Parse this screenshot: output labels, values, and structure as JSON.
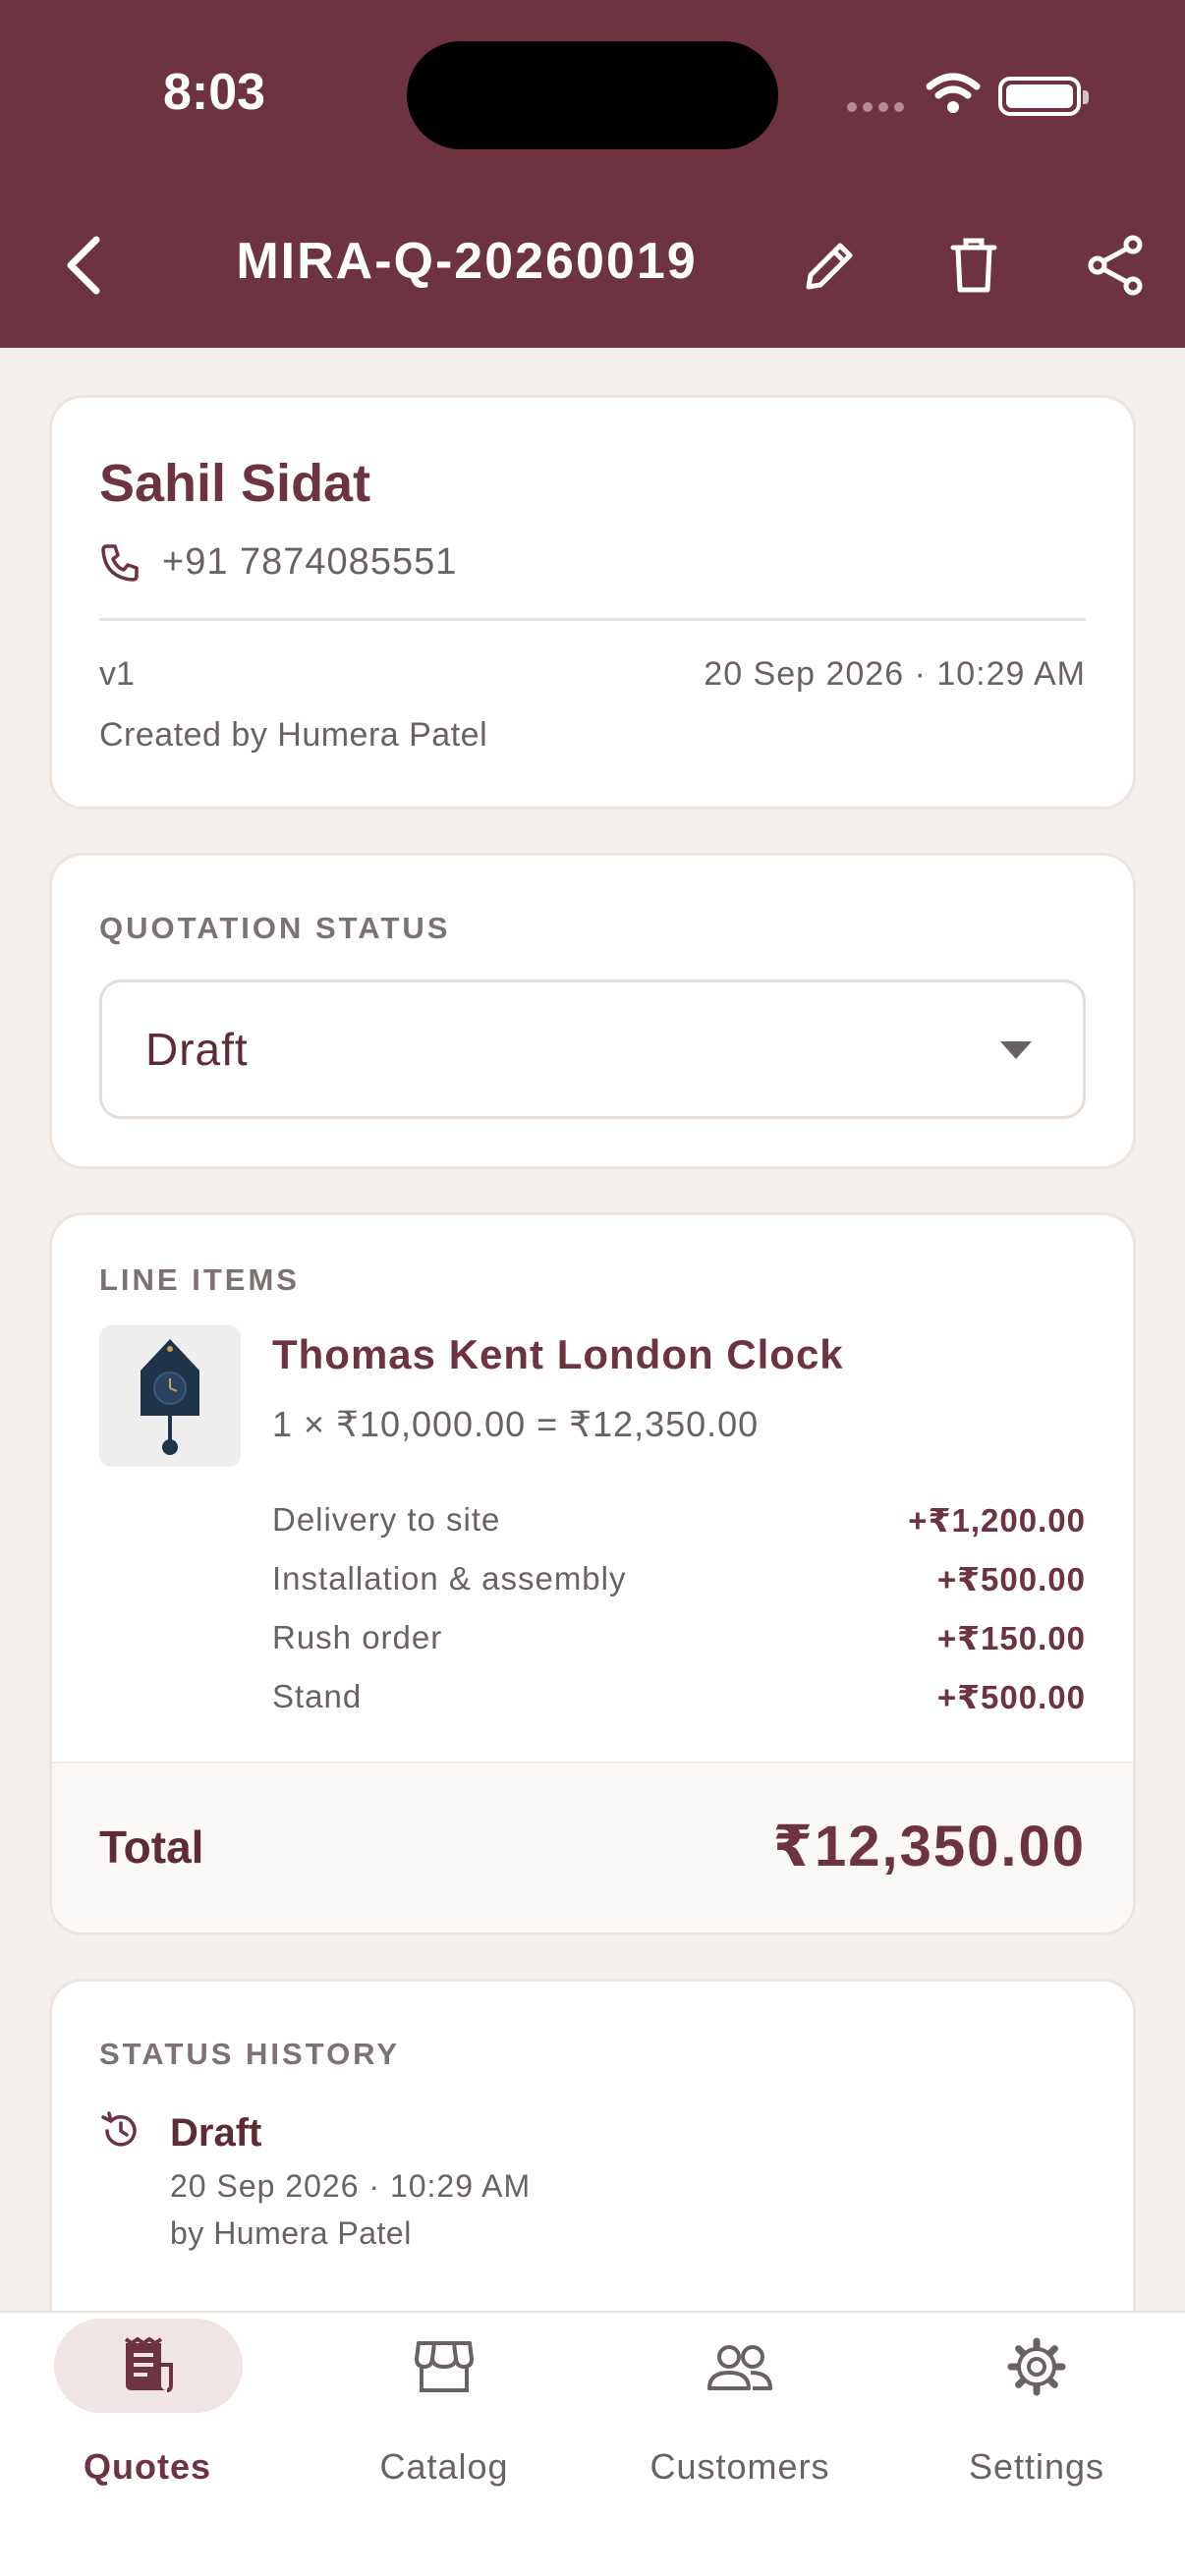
{
  "status_bar": {
    "time": "8:03"
  },
  "app_bar": {
    "title": "MIRA-Q-20260019",
    "back_icon": "back-arrow-icon",
    "edit_icon": "pencil-icon",
    "delete_icon": "trash-icon",
    "share_icon": "share-icon"
  },
  "customer": {
    "name": "Sahil Sidat",
    "phone": "+91 7874085551",
    "version": "v1",
    "datetime": "20 Sep 2026 · 10:29 AM",
    "created_by": "Created by Humera Patel"
  },
  "quotation_status": {
    "label": "QUOTATION STATUS",
    "value": "Draft"
  },
  "line_items": {
    "label": "LINE ITEMS",
    "items": [
      {
        "title": "Thomas Kent London Clock",
        "calc": "1 × ₹10,000.00 = ₹12,350.00",
        "addons": [
          {
            "name": "Delivery to site",
            "price": "+₹1,200.00"
          },
          {
            "name": "Installation & assembly",
            "price": "+₹500.00"
          },
          {
            "name": "Rush order",
            "price": "+₹150.00"
          },
          {
            "name": "Stand",
            "price": "+₹500.00"
          }
        ]
      }
    ],
    "total_label": "Total",
    "total_value": "₹12,350.00"
  },
  "status_history": {
    "label": "STATUS HISTORY",
    "entries": [
      {
        "status": "Draft",
        "date": "20 Sep 2026 · 10:29 AM",
        "by": "by Humera Patel"
      }
    ]
  },
  "bottom_nav": {
    "items": [
      {
        "label": "Quotes",
        "icon": "receipt-icon",
        "active": true
      },
      {
        "label": "Catalog",
        "icon": "storefront-icon",
        "active": false
      },
      {
        "label": "Customers",
        "icon": "people-icon",
        "active": false
      },
      {
        "label": "Settings",
        "icon": "gear-icon",
        "active": false
      }
    ]
  },
  "colors": {
    "primary": "#6d3340",
    "background": "#f3efec",
    "card": "#ffffff",
    "active_pill": "#f0e4e5"
  }
}
